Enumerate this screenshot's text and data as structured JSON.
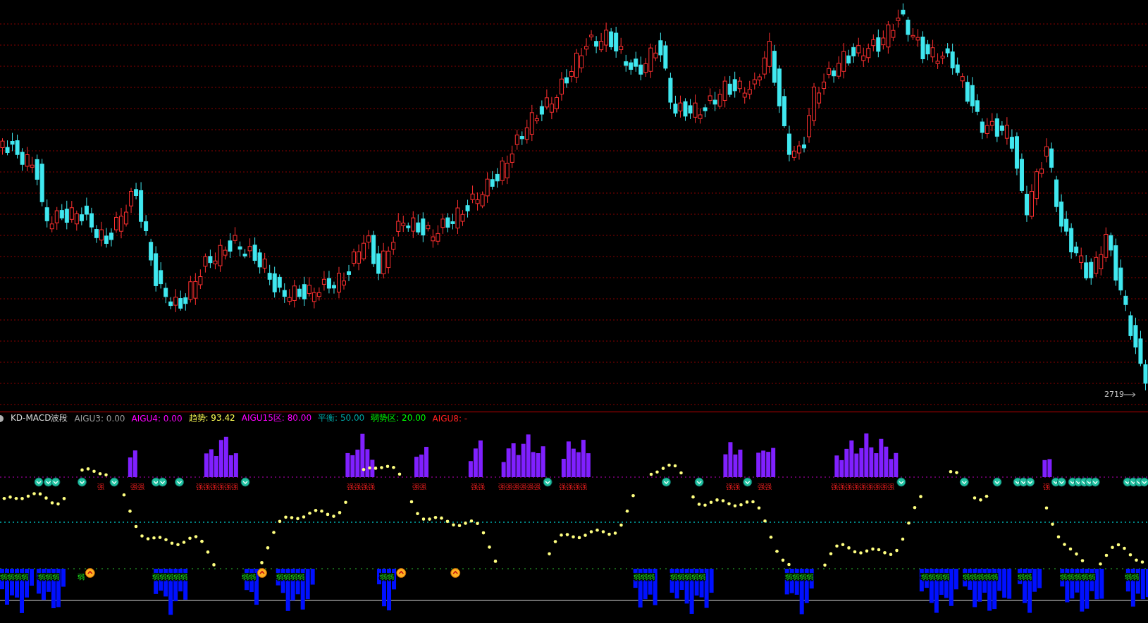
{
  "price_marker": "2719",
  "indicator": {
    "title": "KD-MACD波段",
    "legend": [
      {
        "label": "AIGU3: 0.00",
        "color": "#9a9a9a"
      },
      {
        "label": "AIGU4: 0.00",
        "color": "#ff00ff"
      },
      {
        "label": "趋势: 93.42",
        "color": "#ffff55"
      },
      {
        "label": "AIGU15区: 80.00",
        "color": "#ff00ff"
      },
      {
        "label": "平衡: 50.00",
        "color": "#00a8a8"
      },
      {
        "label": "弱势区: 20.00",
        "color": "#00ff00"
      },
      {
        "label": "AIGU8: -",
        "color": "#ff2020"
      }
    ]
  },
  "strong_labels": [
    "强",
    "强强",
    "强强强强强强",
    "强强强强",
    "强强",
    "强强",
    "强强强强强强",
    "强强强强",
    "强强",
    "强强",
    "强强强强强强强强强",
    "强"
  ],
  "weak_labels": [
    "弱弱弱弱",
    "弱弱弱",
    "弱",
    "弱弱弱弱弱",
    "弱弱",
    "弱弱弱弱",
    "弱弱",
    "弱弱弱",
    "弱弱弱弱弱",
    "弱弱弱弱",
    "弱弱弱弱",
    "弱弱弱弱弱",
    "弱弱",
    "弱弱弱弱弱",
    "弱弱"
  ]
}
